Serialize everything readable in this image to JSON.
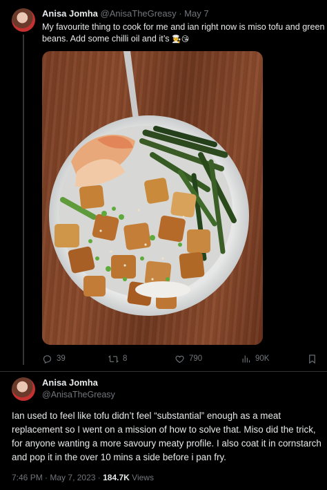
{
  "tweet": {
    "author_name": "Anisa Jomha",
    "handle": "@AnisaTheGreasy",
    "separator": "·",
    "date": "May 7",
    "text": "My favourite thing to cook for me and ian right now is miso tofu and green beans. Add some chilli oil and it’s",
    "emojis": "🧑‍🍳😘",
    "photo_alt": "",
    "actions": {
      "replies": "39",
      "retweets": "8",
      "likes": "790",
      "views": "90K"
    }
  },
  "reply": {
    "author_name": "Anisa Jomha",
    "handle": "@AnisaTheGreasy",
    "text": "Ian used to feel like tofu didn’t feel “substantial” enough as a meat replacement so I went on a mission of how to solve that. Miso did the trick, for anyone wanting a more savoury meaty profile. I also coat it in cornstarch and pop it in the over 10 mins a side before i pan fry.",
    "time": "7:46 PM",
    "date": "May 7, 2023",
    "views_count": "184.7K",
    "views_label": "Views"
  },
  "icons": {
    "reply": "reply-icon",
    "retweet": "retweet-icon",
    "like": "heart-icon",
    "views": "views-chart-icon",
    "bookmark": "bookmark-icon"
  },
  "colors": {
    "background": "#000000",
    "text_primary": "#e7e9ea",
    "text_muted": "#71767b",
    "divider": "#2f3336"
  }
}
